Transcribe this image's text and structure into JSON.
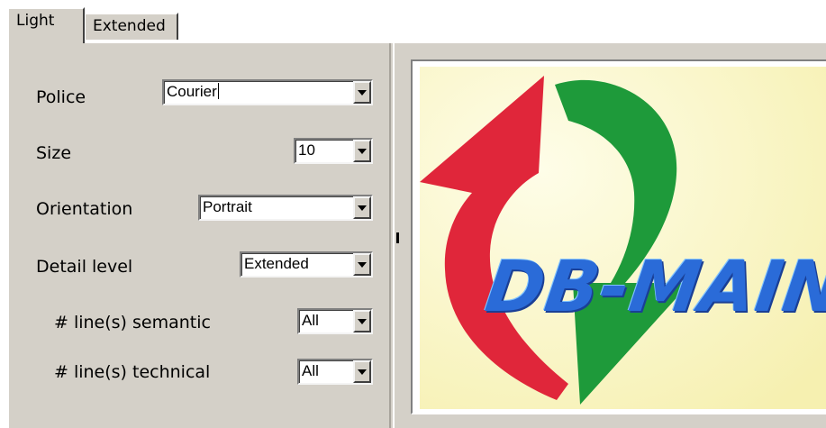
{
  "tabs": {
    "light_label": "Light",
    "extended_label": "Extended"
  },
  "form": {
    "police": {
      "label": "Police",
      "value": "Courier"
    },
    "size": {
      "label": "Size",
      "value": "10"
    },
    "orientation": {
      "label": "Orientation",
      "value": "Portrait"
    },
    "detail_level": {
      "label": "Detail level",
      "value": "Extended"
    },
    "lines_semantic": {
      "label": "# line(s) semantic",
      "value": "All"
    },
    "lines_technical": {
      "label": "# line(s) technical",
      "value": "All"
    }
  },
  "preview": {
    "logo_text": "DB-MAIN",
    "colors": {
      "red_arrow": "#e0263a",
      "green_arrow": "#1e9a3a",
      "text_blue": "#2a6bd8",
      "background": "#fbf7cd",
      "panel": "#d4d0c8"
    }
  }
}
